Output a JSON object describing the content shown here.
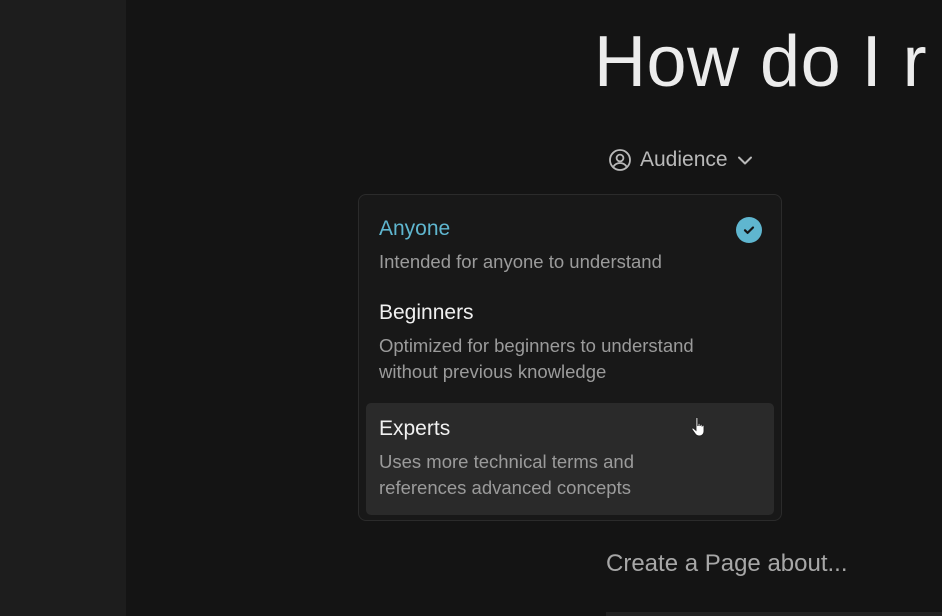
{
  "page": {
    "headline": "How do I r"
  },
  "audience_selector": {
    "label": "Audience",
    "icon": "user-circle-icon",
    "chevron_icon": "chevron-down-icon"
  },
  "audience_menu": {
    "options": [
      {
        "title": "Anyone",
        "description": "Intended for anyone to understand",
        "selected": true
      },
      {
        "title": "Beginners",
        "description_line1": "Optimized for beginners to understand",
        "description_line2": "without previous knowledge",
        "selected": false
      },
      {
        "title": "Experts",
        "description_line1": "Uses more technical terms and",
        "description_line2": "references advanced concepts",
        "selected": false,
        "hovered": true
      }
    ]
  },
  "prompt": {
    "placeholder": "Create a Page about..."
  },
  "colors": {
    "accent": "#5fb6cf",
    "background": "#141414",
    "sidebar": "#1d1d1d",
    "hover": "#2a2a2a"
  }
}
